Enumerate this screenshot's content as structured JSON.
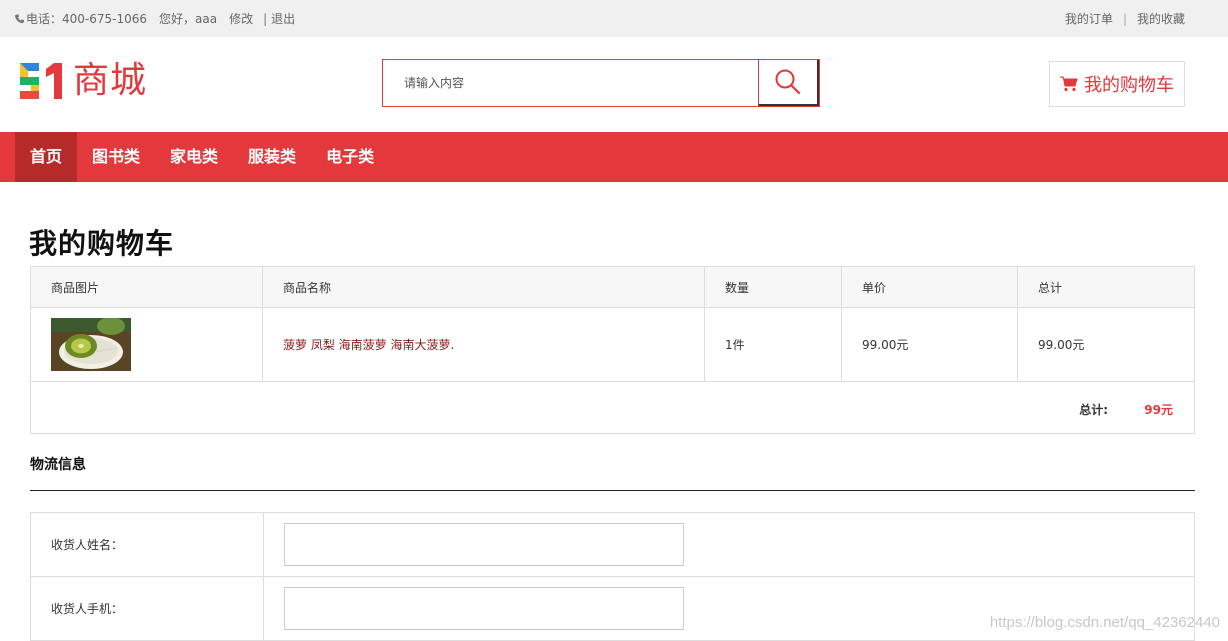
{
  "topbar": {
    "phone": "电话：400-675-1066",
    "greeting": "您好，aaa",
    "edit_link": "修改",
    "logout_link": "退出",
    "logout_separator": "|",
    "orders_link": "我的订单",
    "right_separator": "|",
    "favorites_link": "我的收藏"
  },
  "header": {
    "logo_text": "商城",
    "search_placeholder": "请输入内容",
    "cart_button": "我的购物车"
  },
  "nav": {
    "items": [
      {
        "label": "首页",
        "active": true
      },
      {
        "label": "图书类",
        "active": false
      },
      {
        "label": "家电类",
        "active": false
      },
      {
        "label": "服装类",
        "active": false
      },
      {
        "label": "电子类",
        "active": false
      }
    ]
  },
  "cart": {
    "title": "我的购物车",
    "columns": [
      "商品图片",
      "商品名称",
      "数量",
      "单价",
      "总计"
    ],
    "rows": [
      {
        "name": "菠萝 凤梨 海南菠萝 海南大菠萝.",
        "quantity": "1件",
        "unit_price": "99.00元",
        "subtotal": "99.00元"
      }
    ],
    "total_label": "总计:",
    "total_value": "99元"
  },
  "shipping": {
    "title": "物流信息",
    "fields": [
      {
        "label": "收货人姓名：",
        "value": ""
      },
      {
        "label": "收货人手机：",
        "value": ""
      }
    ]
  },
  "watermark": "https://blog.csdn.net/qq_42362440",
  "colors": {
    "accent": "#e4393c",
    "nav_active": "#b72a2a",
    "product_link": "#8b1a1a"
  }
}
